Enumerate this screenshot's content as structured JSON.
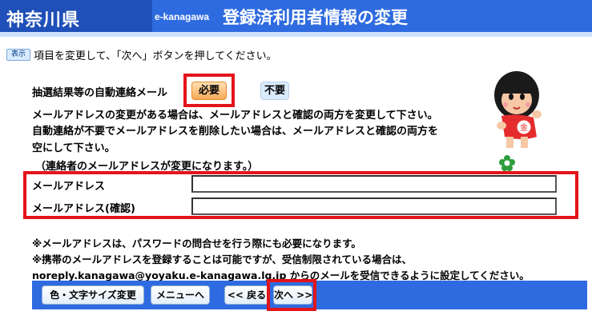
{
  "header": {
    "prefecture": "神奈川県",
    "service": "e-kanagawa",
    "title": "登録済利用者情報の変更"
  },
  "badge": "表示",
  "instruction": "項目を変更して、「次へ」ボタンを押してください。",
  "auto_contact": {
    "label": "抽選結果等の自動連絡メール",
    "required_button": "必要",
    "unneeded_button": "不要"
  },
  "paragraphs": [
    "メールアドレスの変更がある場合は、メールアドレスと確認の両方を変更して下さい。",
    "自動連絡が不要でメールアドレスを削除したい場合は、メールアドレスと確認の両方を",
    "空にして下さい。",
    "（連絡者のメールアドレスが変更になります。）"
  ],
  "fields": {
    "email_label": "メールアドレス",
    "email_value": "",
    "email_confirm_label": "メールアドレス(確認)",
    "email_confirm_value": ""
  },
  "notes": [
    "※メールアドレスは、パスワードの問合せを行う際にも必要になります。",
    "※携帯のメールアドレスを登録することは可能ですが、受信制限されている場合は、",
    "noreply.kanagawa@yoyaku.e-kanagawa.lg.jp からのメールを受信できるように設定してください。"
  ],
  "footer": {
    "font_size_button": "色・文字サイズ変更",
    "menu_button": "メニューへ",
    "back_button": "<< 戻る",
    "next_button": "次へ >>"
  },
  "colors": {
    "header_blue": "#2f6be0",
    "highlight_red": "#e3141b"
  },
  "icons": [
    "mascot-icon",
    "flower-icon"
  ]
}
